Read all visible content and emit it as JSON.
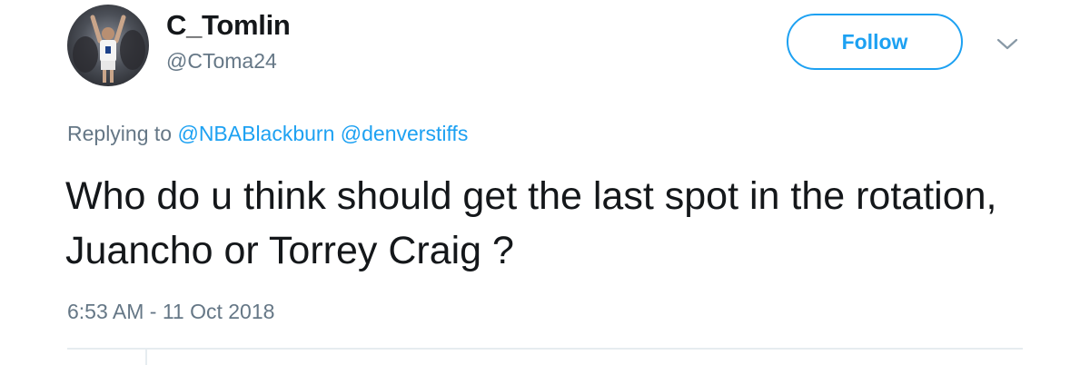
{
  "user": {
    "display_name": "C_Tomlin",
    "handle": "@CToma24"
  },
  "actions": {
    "follow_label": "Follow",
    "menu_icon": "chevron-down-icon"
  },
  "reply": {
    "prefix": "Replying to",
    "mentions": [
      "@NBABlackburn",
      "@denverstiffs"
    ]
  },
  "tweet": {
    "text": "Who do u think should get the last spot in the rotation, Juancho or Torrey Craig ?",
    "timestamp": "6:53 AM - 11 Oct 2018"
  },
  "colors": {
    "accent": "#1da1f2",
    "text": "#14171a",
    "secondary": "#657786",
    "divider": "#e6ecf0"
  }
}
